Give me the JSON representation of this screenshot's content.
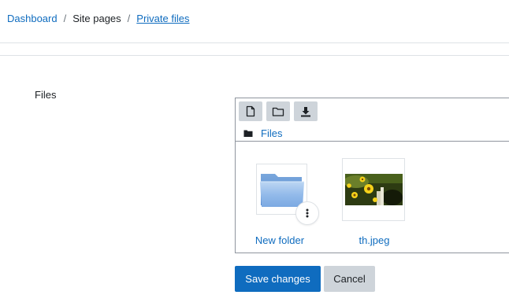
{
  "breadcrumb": {
    "items": [
      {
        "label": "Dashboard"
      },
      {
        "label": "Site pages"
      },
      {
        "label": "Private files"
      }
    ],
    "separator": "/"
  },
  "form": {
    "field_label": "Files"
  },
  "filepicker": {
    "toolbar": [
      {
        "icon": "add-file-icon"
      },
      {
        "icon": "create-folder-icon"
      },
      {
        "icon": "download-icon"
      }
    ],
    "path": {
      "icon": "folder-icon",
      "label": "Files"
    },
    "items": [
      {
        "name": "New folder",
        "type": "folder",
        "icon": "folder-icon"
      },
      {
        "name": "th.jpeg",
        "type": "image",
        "icon": "image-thumbnail"
      }
    ]
  },
  "actions": {
    "save_label": "Save changes",
    "cancel_label": "Cancel"
  },
  "colors": {
    "link": "#0f6cbf",
    "primary": "#0f6cbf",
    "secondary": "#ced4da",
    "border": "#8f959e"
  }
}
